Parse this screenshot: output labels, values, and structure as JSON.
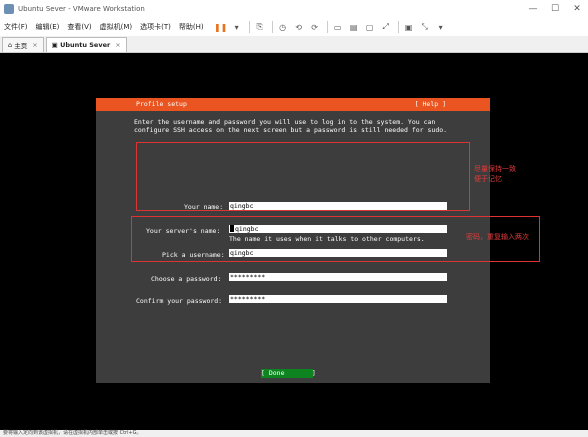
{
  "window": {
    "title": "Ubuntu Sever - VMware Workstation",
    "controls": {
      "minimize": "—",
      "maximize": "☐",
      "close": "✕"
    }
  },
  "menu": {
    "items": [
      "文件(F)",
      "编辑(E)",
      "查看(V)",
      "虚拟机(M)",
      "选项卡(T)",
      "帮助(H)"
    ]
  },
  "tabs": [
    {
      "label": "主页",
      "icon": "home-icon"
    },
    {
      "label": "Ubuntu Sever",
      "icon": "vm-icon",
      "active": true
    }
  ],
  "installer": {
    "header_title": "Profile setup",
    "help_label": "[ Help ]",
    "intro": "Enter the username and password you will use to log in to the system. You can configure SSH access on the next screen but a password is still needed for sudo.",
    "fields": {
      "your_name": {
        "label": "Your name:",
        "value": "qingbc"
      },
      "server_name": {
        "label": "Your server's name:",
        "value": "qingbc",
        "hint": "The name it uses when it talks to other computers."
      },
      "username": {
        "label": "Pick a username:",
        "value": "qingbc"
      },
      "password": {
        "label": "Choose a password:",
        "value": "*********"
      },
      "confirm_password": {
        "label": "Confirm your password:",
        "value": "*********"
      }
    },
    "done_label": "[ Done       ]"
  },
  "annotations": {
    "names_note_line1": "尽量保持一致",
    "names_note_line2": "便于记忆",
    "password_note": "密码，重复输入两次"
  },
  "statusbar": {
    "text": "要将输入定向到该虚拟机，请在虚拟机内部单击或按 Ctrl+G。"
  },
  "colors": {
    "header_orange": "#e95420",
    "installer_bg": "#3d3d3d",
    "done_green": "#0e8420",
    "annotation_red": "#e03a3a"
  }
}
